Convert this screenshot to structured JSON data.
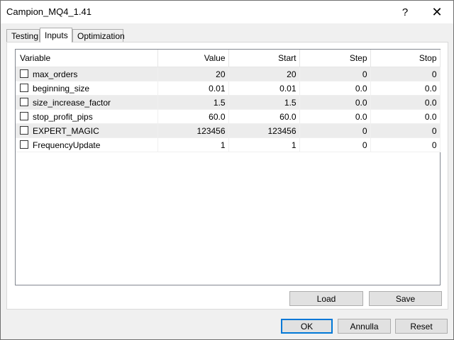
{
  "window": {
    "title": "Campion_MQ4_1.41",
    "help_glyph": "?",
    "close_glyph": "✕"
  },
  "tabs": [
    {
      "label": "Testing"
    },
    {
      "label": "Inputs",
      "active": true
    },
    {
      "label": "Optimization"
    }
  ],
  "grid": {
    "columns": [
      "Variable",
      "Value",
      "Start",
      "Step",
      "Stop"
    ],
    "rows": [
      {
        "name": "max_orders",
        "value": "20",
        "start": "20",
        "step": "0",
        "stop": "0",
        "checked": false
      },
      {
        "name": "beginning_size",
        "value": "0.01",
        "start": "0.01",
        "step": "0.0",
        "stop": "0.0",
        "checked": false
      },
      {
        "name": "size_increase_factor",
        "value": "1.5",
        "start": "1.5",
        "step": "0.0",
        "stop": "0.0",
        "checked": false
      },
      {
        "name": "stop_profit_pips",
        "value": "60.0",
        "start": "60.0",
        "step": "0.0",
        "stop": "0.0",
        "checked": false
      },
      {
        "name": "EXPERT_MAGIC",
        "value": "123456",
        "start": "123456",
        "step": "0",
        "stop": "0",
        "checked": false
      },
      {
        "name": "FrequencyUpdate",
        "value": "1",
        "start": "1",
        "step": "0",
        "stop": "0",
        "checked": false
      }
    ]
  },
  "buttons": {
    "load": "Load",
    "save": "Save",
    "ok": "OK",
    "annulla": "Annulla",
    "reset": "Reset"
  }
}
